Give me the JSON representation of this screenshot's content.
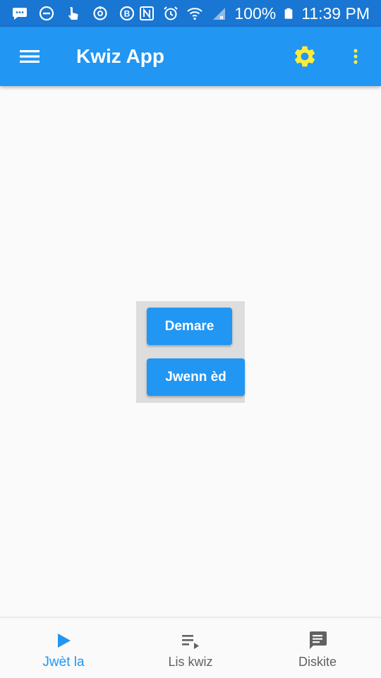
{
  "status_bar": {
    "battery_percent": "100%",
    "time": "11:39 PM"
  },
  "app_bar": {
    "title": "Kwiz App"
  },
  "main": {
    "start_button_label": "Demare",
    "help_button_label": "Jwenn èd"
  },
  "bottom_nav": {
    "items": [
      {
        "label": "Jwèt la",
        "icon": "play-icon",
        "active": true
      },
      {
        "label": "Lis kwiz",
        "icon": "playlist-play-icon",
        "active": false
      },
      {
        "label": "Diskite",
        "icon": "chat-icon",
        "active": false
      }
    ]
  },
  "colors": {
    "status_bar": "#1976d2",
    "app_bar": "#2196f3",
    "settings_icon": "#ffeb3b",
    "accent": "#2196f3",
    "panel": "#dddddd",
    "nav_inactive": "#616161"
  }
}
